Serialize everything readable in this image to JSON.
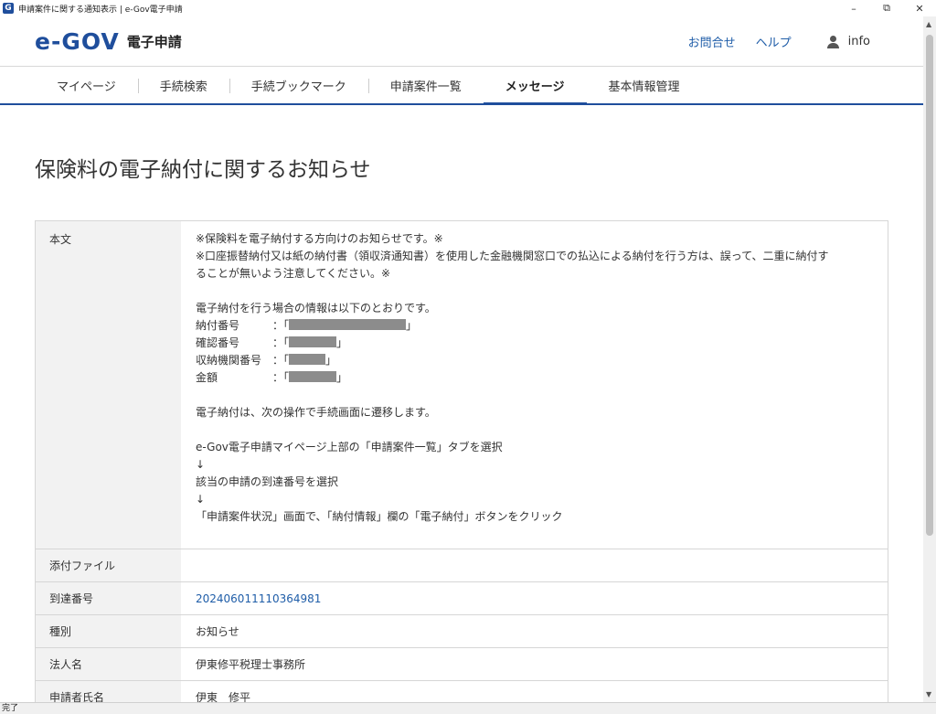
{
  "window": {
    "app_icon_letter": "G",
    "title": "申請案件に関する通知表示 | e-Gov電子申請",
    "controls": {
      "minimize": "–",
      "restore": "⧉",
      "close": "✕"
    }
  },
  "header": {
    "logo_text": "e-GOV",
    "logo_sub": "電子申請",
    "links": {
      "contact": "お問合せ",
      "help": "ヘルプ"
    },
    "user": {
      "name": "info"
    }
  },
  "nav": {
    "items": [
      {
        "label": "マイページ",
        "active": false
      },
      {
        "label": "手続検索",
        "active": false
      },
      {
        "label": "手続ブックマーク",
        "active": false
      },
      {
        "label": "申請案件一覧",
        "active": false
      },
      {
        "label": "メッセージ",
        "active": true
      },
      {
        "label": "基本情報管理",
        "active": false
      }
    ]
  },
  "page": {
    "title": "保険料の電子納付に関するお知らせ"
  },
  "detail": {
    "body_label": "本文",
    "body": {
      "line1": "※保険料を電子納付する方向けのお知らせです。※",
      "line2": "※口座振替納付又は紙の納付書（領収済通知書）を使用した金融機関窓口での払込による納付を行う方は、誤って、二重に納付す",
      "line3": "ることが無いよう注意してください。※",
      "line4": "電子納付を行う場合の情報は以下のとおりです。",
      "fields": [
        {
          "label": "納付番号",
          "sep": "：「",
          "close": "」"
        },
        {
          "label": "確認番号",
          "sep": "：「",
          "close": "」"
        },
        {
          "label": "収納機関番号",
          "sep": "：「",
          "close": "」"
        },
        {
          "label": "金額",
          "sep": "：「",
          "close": "」"
        }
      ],
      "line5": "電子納付は、次の操作で手続画面に遷移します。",
      "step1": "e-Gov電子申請マイページ上部の「申請案件一覧」タブを選択",
      "arrow": "↓",
      "step2": "該当の申請の到達番号を選択",
      "step3": "「申請案件状況」画面で、「納付情報」欄の「電子納付」ボタンをクリック"
    },
    "attachment_label": "添付ファイル",
    "attachment_value": "",
    "arrival_label": "到達番号",
    "arrival_value": "202406011110364981",
    "type_label": "種別",
    "type_value": "お知らせ",
    "corp_label": "法人名",
    "corp_value": "伊東修平税理士事務所",
    "applicant_label": "申請者氏名",
    "applicant_value": "伊東　修平"
  },
  "statusbar": {
    "text": "完了"
  },
  "colors": {
    "brand": "#1f4e9c",
    "link": "#1f5da8",
    "redaction": "#8c8c8c"
  }
}
